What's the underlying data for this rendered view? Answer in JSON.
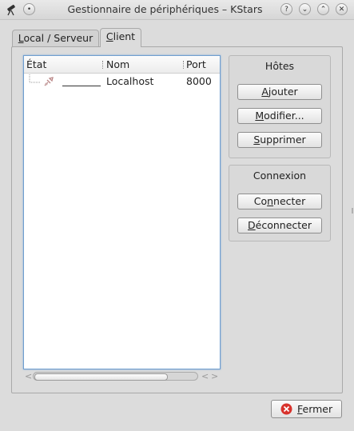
{
  "window": {
    "title": "Gestionnaire de périphériques – KStars",
    "buttons": [
      "?",
      "⌄",
      "⌃",
      "✕"
    ]
  },
  "tabs": [
    {
      "label": "Local / Serveur",
      "mnemonic": "L",
      "rest": "ocal / Serveur"
    },
    {
      "label": "Client",
      "mnemonic": "C",
      "rest": "lient"
    }
  ],
  "tree": {
    "columns": [
      "État",
      "Nom",
      "Port"
    ],
    "rows": [
      {
        "state": "disconnected",
        "name": "Localhost",
        "port": "8000"
      }
    ]
  },
  "hosts_group": {
    "title": "Hôtes",
    "buttons": [
      {
        "label": "Ajouter",
        "mnemonic": "A",
        "rest": "jouter"
      },
      {
        "label": "Modifier...",
        "mnemonic": "M",
        "rest": "odifier..."
      },
      {
        "label": "Supprimer",
        "mnemonic": "S",
        "rest": "upprimer"
      }
    ]
  },
  "connection_group": {
    "title": "Connexion",
    "buttons": [
      {
        "label": "Connecter",
        "pre": "Co",
        "mnemonic": "n",
        "rest": "necter"
      },
      {
        "label": "Déconnecter",
        "mnemonic": "D",
        "rest": "éconnecter"
      }
    ]
  },
  "close_button": {
    "label": "Fermer",
    "mnemonic": "F",
    "rest": "ermer"
  }
}
